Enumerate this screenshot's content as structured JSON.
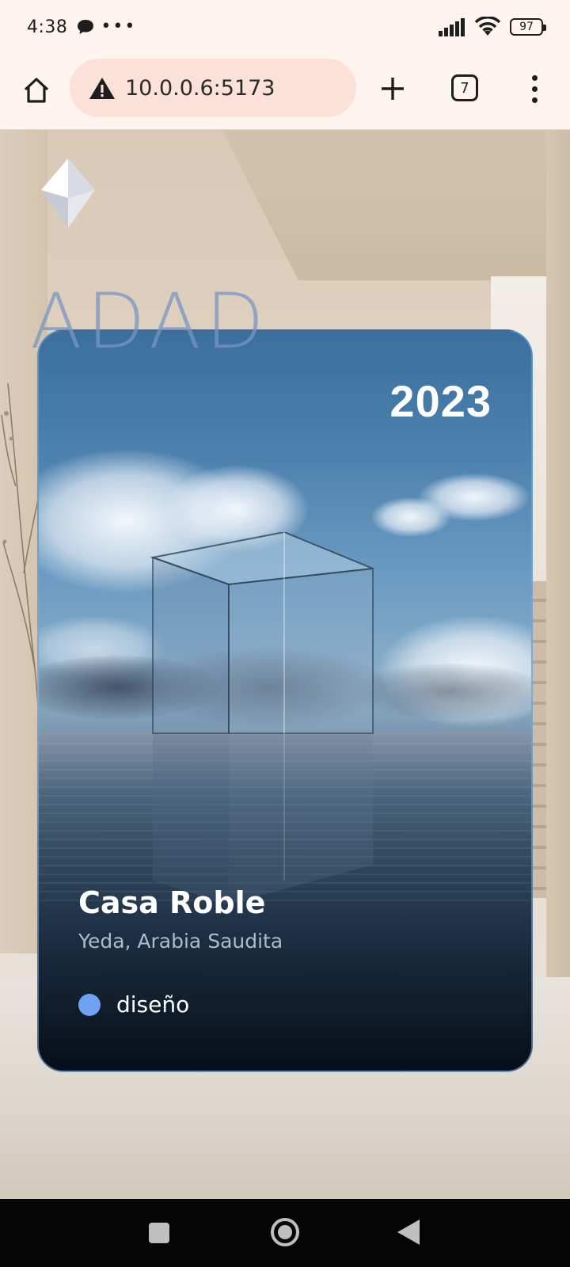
{
  "status_bar": {
    "time": "4:38",
    "dots": "•••",
    "battery": "97"
  },
  "browser": {
    "url": "10.0.0.6:5173",
    "tab_count": "7"
  },
  "brand": {
    "wordmark": "ADAD",
    "accent_color": "#7896c3"
  },
  "project_card": {
    "year": "2023",
    "title": "Casa Roble",
    "location": "Yeda, Arabia Saudita",
    "tag": {
      "label": "diseño",
      "color": "#6ea3f2"
    }
  }
}
